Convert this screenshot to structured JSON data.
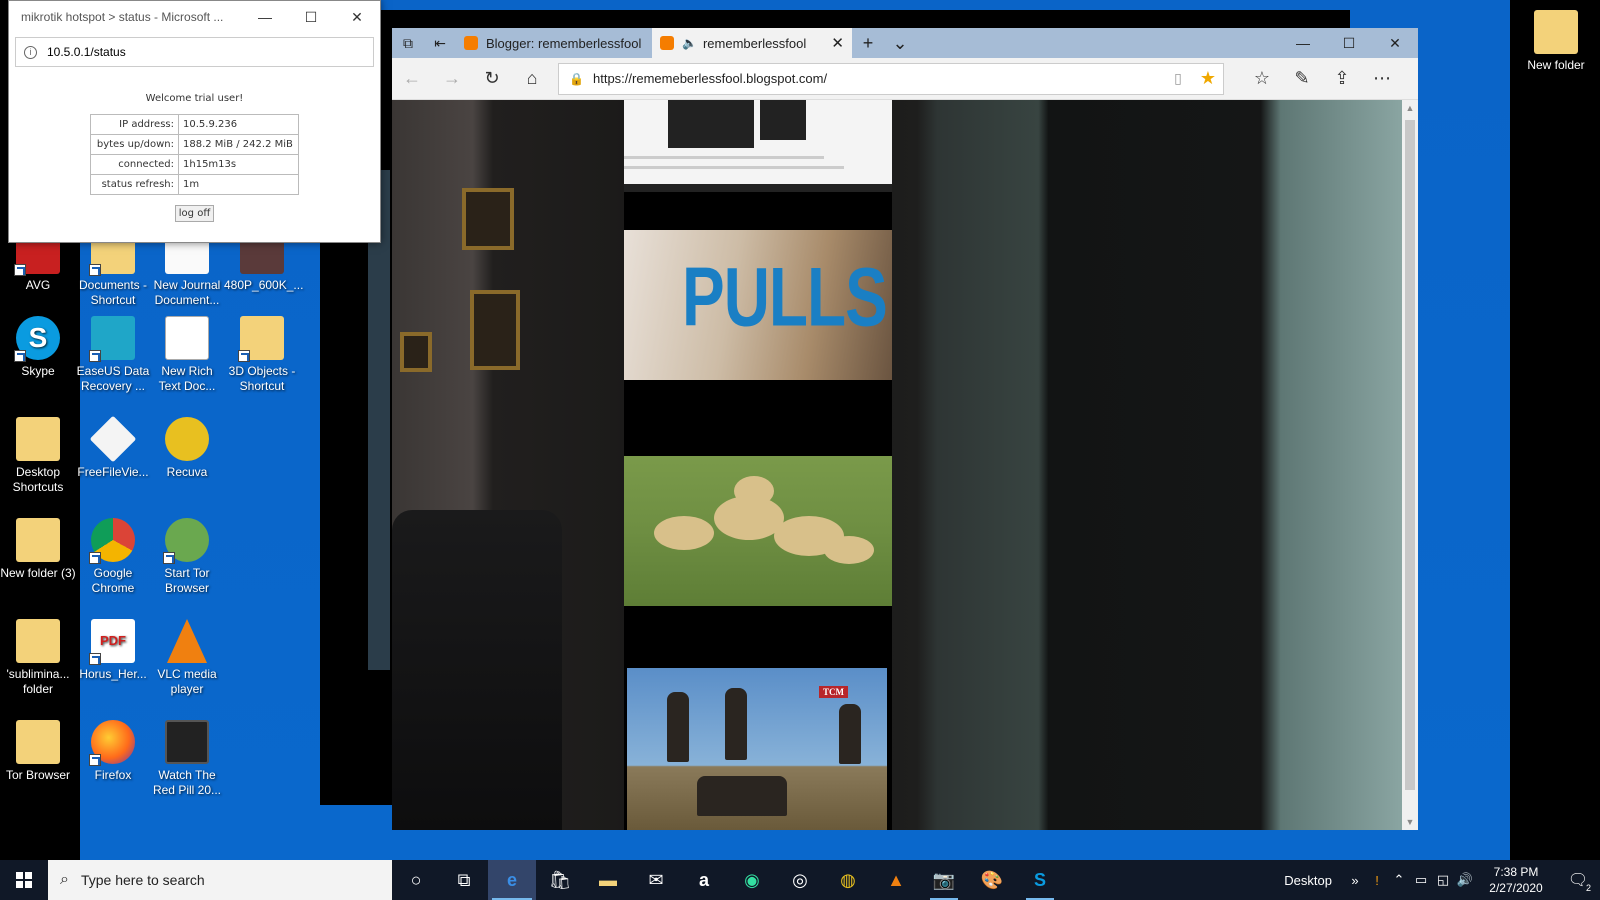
{
  "hotspot": {
    "window_title": "mikrotik hotspot > status - Microsoft ...",
    "address": "10.5.0.1/status",
    "welcome": "Welcome trial user!",
    "rows": [
      {
        "key": "IP address:",
        "value": "10.5.9.236"
      },
      {
        "key": "bytes up/down:",
        "value": "188.2 MiB / 242.2 MiB"
      },
      {
        "key": "connected:",
        "value": "1h15m13s"
      },
      {
        "key": "status refresh:",
        "value": "1m"
      }
    ],
    "logoff_label": "log off"
  },
  "edge": {
    "tabs": [
      {
        "label": "Blogger: rememberlessfool",
        "active": false
      },
      {
        "label": "rememberlessfool",
        "active": true
      }
    ],
    "url": "https://rememeberlessfool.blogspot.com/",
    "post_overlay_text": "PULLS",
    "tcm_badge": "TCM"
  },
  "desktop": {
    "icons_top": [
      {
        "label": "AVG"
      },
      {
        "label": "Documents - Shortcut"
      },
      {
        "label": "New Journal Document..."
      },
      {
        "label": "480P_600K_..."
      }
    ],
    "icons": [
      {
        "label": "Skype"
      },
      {
        "label": "EaseUS Data Recovery ..."
      },
      {
        "label": "New Rich Text Doc..."
      },
      {
        "label": "3D Objects - Shortcut"
      },
      {
        "label": "Desktop Shortcuts"
      },
      {
        "label": "FreeFileVie..."
      },
      {
        "label": "Recuva"
      },
      {
        "label": "New folder (3)"
      },
      {
        "label": "Google Chrome"
      },
      {
        "label": "Start Tor Browser"
      },
      {
        "label": "'sublimina... folder"
      },
      {
        "label": "Horus_Her..."
      },
      {
        "label": "VLC media player"
      },
      {
        "label": "Tor Browser"
      },
      {
        "label": "Firefox"
      },
      {
        "label": "Watch The Red Pill 20..."
      },
      {
        "label": "New folder"
      }
    ]
  },
  "taskbar": {
    "search_placeholder": "Type here to search",
    "desktop_label": "Desktop",
    "time": "7:38 PM",
    "date": "2/27/2020",
    "notification_count": "2"
  },
  "colors": {
    "desktop_blue": "#0a64c8",
    "taskbar": "#101827",
    "edge_tabbar": "#a6bcd6",
    "favorite_star": "#f0a800",
    "blogger_orange": "#f57d00"
  }
}
